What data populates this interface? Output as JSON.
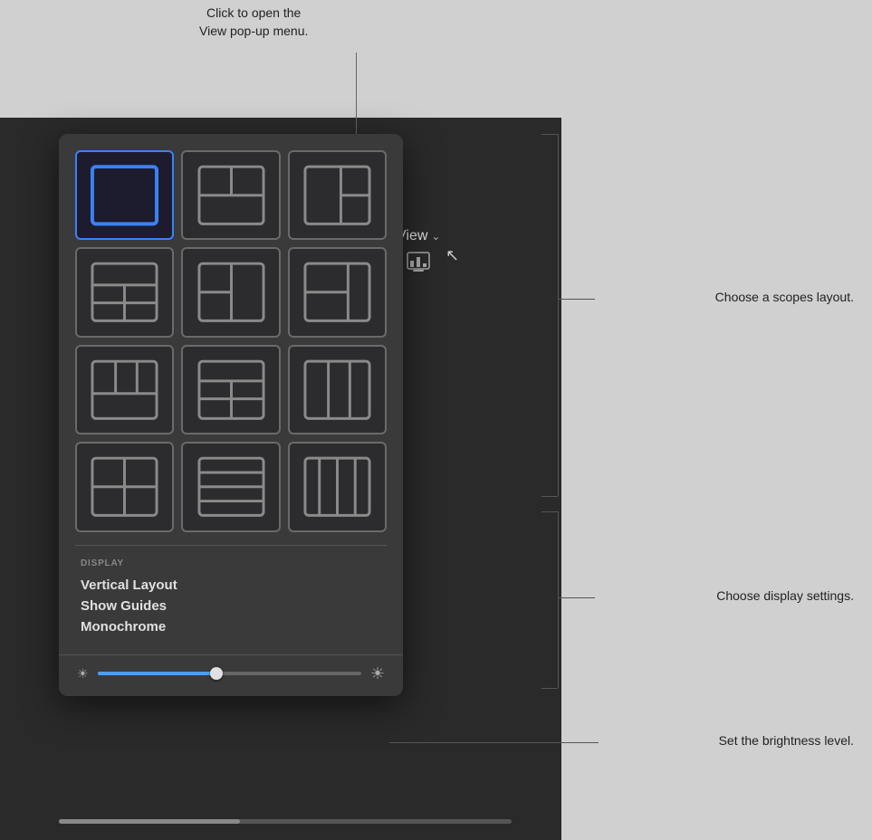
{
  "callout_top": {
    "line1": "Click to open the",
    "line2": "View pop-up menu."
  },
  "annotations": {
    "scopes_layout": "Choose a scopes layout.",
    "display_settings": "Choose display settings.",
    "brightness_level": "Set the brightness level."
  },
  "view_button": {
    "label": "View",
    "chevron": "∨"
  },
  "popup": {
    "grid_items": [
      {
        "id": "single",
        "selected": true
      },
      {
        "id": "top-split",
        "selected": false
      },
      {
        "id": "right-split",
        "selected": false
      },
      {
        "id": "bottom-left-split",
        "selected": false
      },
      {
        "id": "four-panel",
        "selected": false
      },
      {
        "id": "left-wide",
        "selected": false
      },
      {
        "id": "top-bottom-left",
        "selected": false
      },
      {
        "id": "three-row",
        "selected": false
      },
      {
        "id": "three-col",
        "selected": false
      },
      {
        "id": "four-equal",
        "selected": false
      },
      {
        "id": "multi-row",
        "selected": false
      },
      {
        "id": "multi-col",
        "selected": false
      }
    ],
    "display_section": {
      "label": "DISPLAY",
      "items": [
        {
          "label": "Vertical Layout"
        },
        {
          "label": "Show Guides"
        },
        {
          "label": "Monochrome"
        }
      ]
    },
    "brightness": {
      "value": 45
    }
  }
}
